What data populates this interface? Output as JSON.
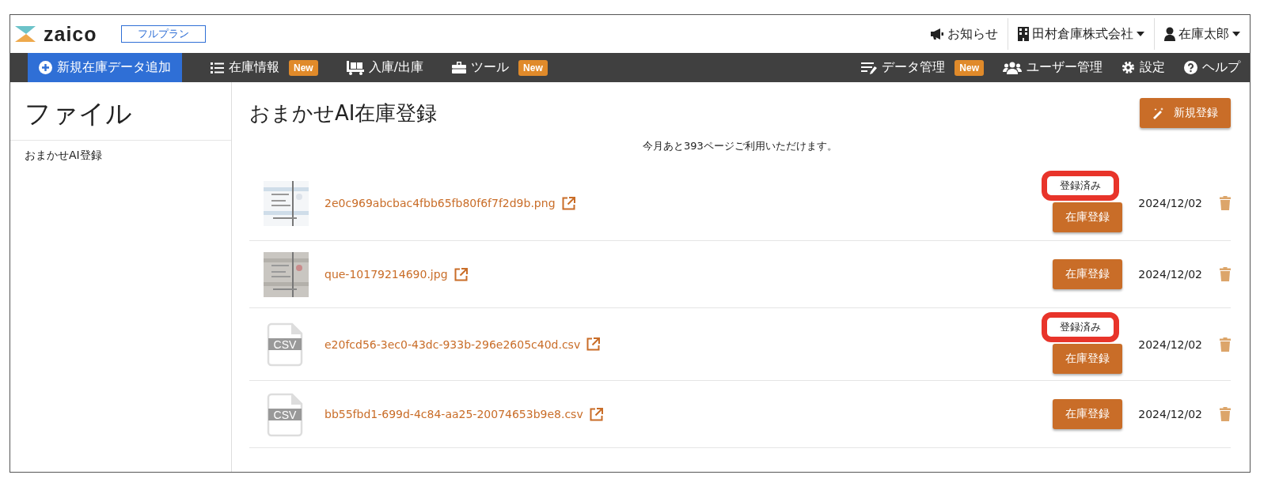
{
  "header": {
    "logo": "zaico",
    "plan": "フルプラン",
    "links": [
      {
        "kind": "notice",
        "label": "お知らせ"
      },
      {
        "kind": "company",
        "label": "田村倉庫株式会社"
      },
      {
        "kind": "user",
        "label": "在庫太郎"
      }
    ]
  },
  "nav": {
    "left": [
      {
        "kind": "add",
        "label": "新規在庫データ追加",
        "selected": true
      },
      {
        "kind": "list",
        "label": "在庫情報",
        "badge": "New",
        "selected": false
      },
      {
        "kind": "cart",
        "label": "入庫/出庫",
        "selected": false
      },
      {
        "kind": "toolbox",
        "label": "ツール",
        "badge": "New",
        "selected": false
      }
    ],
    "right": [
      {
        "kind": "data",
        "label": "データ管理",
        "badge": "New",
        "selected": false
      },
      {
        "kind": "users",
        "label": "ユーザー管理",
        "selected": false
      },
      {
        "kind": "gear",
        "label": "設定",
        "selected": false
      },
      {
        "kind": "help",
        "label": "ヘルプ",
        "selected": false
      }
    ]
  },
  "sidebar": {
    "title": "ファイル",
    "items": [
      {
        "label": "おまかせAI登録"
      }
    ]
  },
  "main": {
    "title": "おまかせAI在庫登録",
    "new_button": "新規登録",
    "notice": "今月あと393ページご利用いただけます。",
    "rows": [
      {
        "kind": "picture",
        "file": "2e0c969abcbac4fbb65fb80f6f7f2d9b.png",
        "status": "登録済み",
        "registered": true,
        "button": "在庫登録",
        "date": "2024/12/02"
      },
      {
        "kind": "picture",
        "file": "que-10179214690.jpg",
        "registered": false,
        "button": "在庫登録",
        "date": "2024/12/02"
      },
      {
        "kind": "csv",
        "icon_text": "CSV",
        "file": "e20fcd56-3ec0-43dc-933b-296e2605c40d.csv",
        "status": "登録済み",
        "registered": true,
        "button": "在庫登録",
        "date": "2024/12/02"
      },
      {
        "kind": "csv",
        "icon_text": "CSV",
        "file": "bb55fbd1-699d-4c84-aa25-20074653b9e8.csv",
        "registered": false,
        "button": "在庫登録",
        "date": "2024/12/02"
      }
    ]
  }
}
